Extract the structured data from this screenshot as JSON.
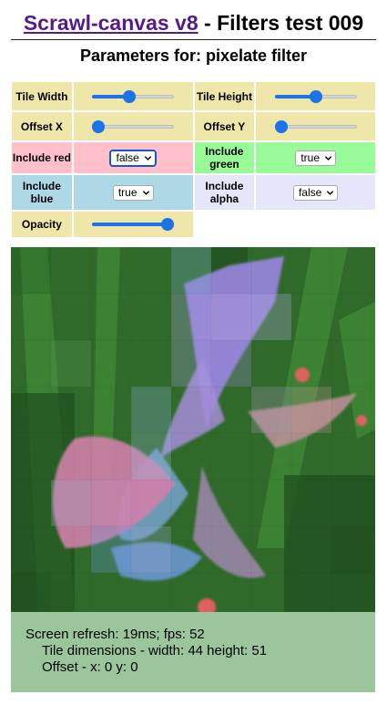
{
  "header": {
    "link_text": "Scrawl-canvas v8",
    "title_suffix": " - Filters test 009",
    "subtitle": "Parameters for: pixelate filter"
  },
  "controls": {
    "tile_width": {
      "label": "Tile Width",
      "value_fraction": 0.44
    },
    "tile_height": {
      "label": "Tile Height",
      "value_fraction": 0.51
    },
    "offset_x": {
      "label": "Offset X",
      "value_fraction": 0.0
    },
    "offset_y": {
      "label": "Offset Y",
      "value_fraction": 0.0
    },
    "include_red": {
      "label": "Include red",
      "selected": "false"
    },
    "include_green": {
      "label": "Include green",
      "selected": "true"
    },
    "include_blue": {
      "label": "Include blue",
      "selected": "true"
    },
    "include_alpha": {
      "label": "Include alpha",
      "selected": "false"
    },
    "opacity": {
      "label": "Opacity",
      "value_fraction": 1.0
    }
  },
  "report": {
    "line1": "Screen refresh: 19ms; fps: 52",
    "line2": "Tile dimensions - width: 44 height: 51",
    "line3": "Offset - x: 0 y: 0"
  },
  "colors": {
    "label_khaki": "#efe6aa",
    "red_bg": "#ffc0cb",
    "green_bg": "#98fb98",
    "blue_bg": "#add8e6",
    "alpha_bg": "#e6e6fa",
    "report_bg": "#9bc59b",
    "slider_accent": "#1a73e8"
  }
}
